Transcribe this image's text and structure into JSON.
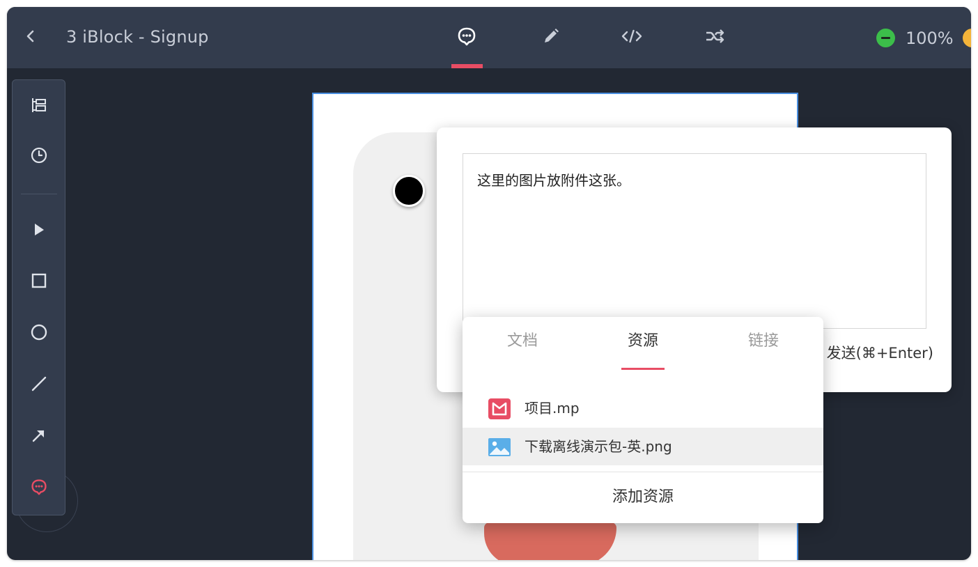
{
  "header": {
    "title": "3 iBlock - Signup",
    "zoom": "100%",
    "active_mode": "comment",
    "modes": [
      "comment-icon",
      "pencil-icon",
      "code-icon",
      "shuffle-icon"
    ]
  },
  "toolbar": {
    "tools": [
      "layers-icon",
      "history-icon",
      "pointer-icon",
      "rectangle-icon",
      "ellipse-icon",
      "line-icon",
      "arrow-icon",
      "comment-icon"
    ],
    "active_tool": "comment-icon"
  },
  "comment": {
    "text": "这里的图片放附件这张。",
    "send_hint": "发送(⌘+Enter)"
  },
  "attach_menu": {
    "tabs": [
      "文档",
      "资源",
      "链接"
    ],
    "active_tab": 1,
    "items": [
      {
        "name": "项目.mp",
        "icon": "project-file-icon"
      },
      {
        "name": "下载离线演示包-英.png",
        "icon": "image-file-icon"
      }
    ],
    "add_label": "添加资源"
  },
  "colors": {
    "accent": "#e84d64",
    "topbar": "#333c4d",
    "canvas": "#222833",
    "zoom_out": "#3cbe4a",
    "zoom_in": "#f4b43a",
    "image_icon": "#5aaee8"
  }
}
